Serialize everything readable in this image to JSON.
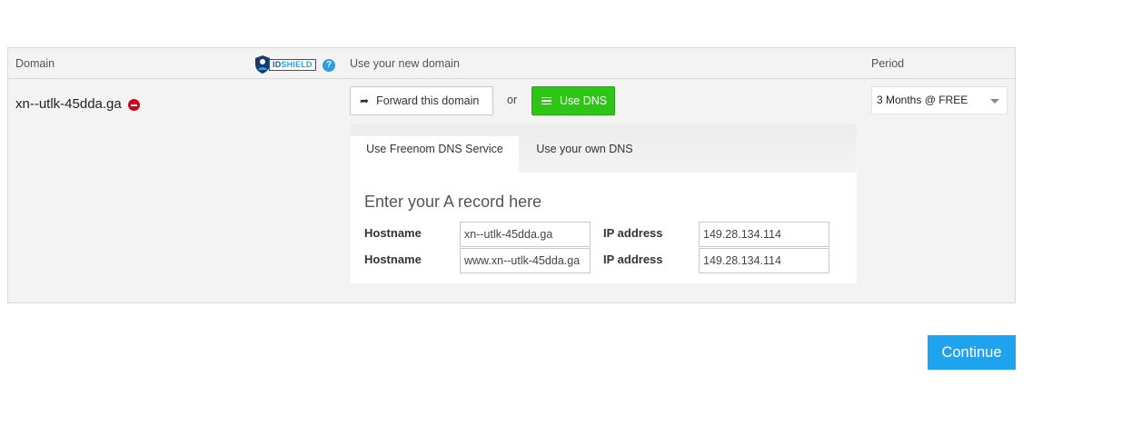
{
  "table": {
    "headers": {
      "domain": "Domain",
      "use_new_domain": "Use your new domain",
      "period": "Period"
    },
    "idshield": {
      "id_part": "ID",
      "shield_part": "SHIELD",
      "help_glyph": "?"
    }
  },
  "row": {
    "domain_name": "xn--utlk-45dda.ga",
    "forward_button": "Forward this domain",
    "or_text": "or",
    "use_dns_button": "Use DNS",
    "period_value": "3 Months @ FREE"
  },
  "dns": {
    "tabs": [
      "Use Freenom DNS Service",
      "Use your own DNS"
    ],
    "active_tab": "Use Freenom DNS Service",
    "title": "Enter your A record here",
    "records": [
      {
        "hostname_label": "Hostname",
        "hostname_value": "xn--utlk-45dda.ga",
        "ip_label": "IP address",
        "ip_value": "149.28.134.114"
      },
      {
        "hostname_label": "Hostname",
        "hostname_value": "www.xn--utlk-45dda.ga",
        "ip_label": "IP address",
        "ip_value": "149.28.134.114"
      }
    ]
  },
  "continue_button": "Continue",
  "icons": {
    "shield": "shield-icon",
    "help": "help-icon",
    "remove": "remove-icon",
    "forward": "share-forward-icon",
    "list": "list-icon",
    "dropdown": "caret-down-icon"
  },
  "colors": {
    "accent_blue": "#1ea4ee",
    "dns_green": "#2ec616",
    "remove_red": "#d0021b"
  }
}
